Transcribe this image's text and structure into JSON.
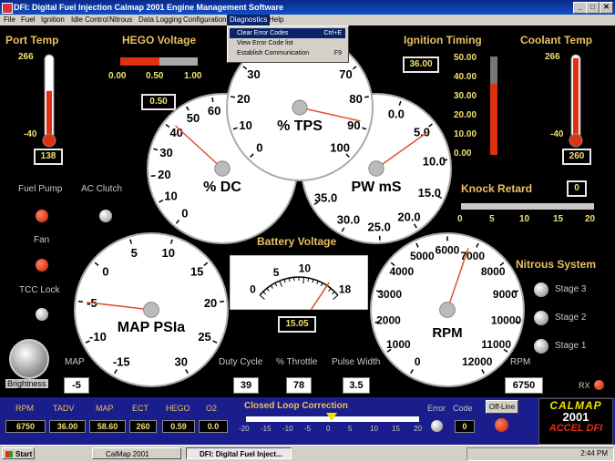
{
  "window": {
    "title": "DFI: Digital Fuel Injection   Calmap 2001 Engine Management Software"
  },
  "menu": [
    "File",
    "Fuel",
    "Ignition",
    "Idle Control",
    "Nitrous",
    "Data Logging",
    "Configuration",
    "Diagnostics",
    "Help"
  ],
  "dropdown": {
    "items": [
      {
        "label": "Clear Error Codes",
        "shortcut": "Ctrl+E"
      },
      {
        "label": "View Error Code list",
        "shortcut": ""
      },
      {
        "label": "Establish Communication",
        "shortcut": "F9"
      }
    ]
  },
  "port_temp": {
    "label": "Port Temp",
    "ticks": [
      "266",
      "-40"
    ],
    "value": "138",
    "level": 0.58
  },
  "coolant_temp": {
    "label": "Coolant Temp",
    "ticks": [
      "266",
      "-40"
    ],
    "value": "260",
    "level": 0.98
  },
  "hego": {
    "label": "HEGO Voltage",
    "ticks": [
      "0.00",
      "0.50",
      "1.00"
    ],
    "value": "0.50"
  },
  "ignition_timing": {
    "label": "Ignition Timing",
    "value": "36.00",
    "ticks": [
      "50.00",
      "40.00",
      "30.00",
      "20.00",
      "10.00",
      "0.00"
    ],
    "level": 0.72
  },
  "tps": {
    "label": "% TPS",
    "ticks": [
      "0",
      "10",
      "20",
      "30",
      "40",
      "50",
      "60",
      "70",
      "80",
      "90",
      "100"
    ],
    "value": 88
  },
  "dc": {
    "label": "% DC",
    "ticks": [
      "0",
      "10",
      "20",
      "30",
      "40",
      "50",
      "60",
      "70",
      "80",
      "90",
      "100"
    ],
    "value": 42
  },
  "pw": {
    "label": "PW mS",
    "ticks": [
      "0.0",
      "5.0",
      "10.0",
      "15.0",
      "20.0",
      "25.0",
      "30.0",
      "35.0"
    ],
    "value": 5.5
  },
  "map": {
    "label": "MAP PSIa",
    "ticks": [
      "-15",
      "-10",
      "-5",
      "0",
      "5",
      "10",
      "15",
      "20",
      "25",
      "30"
    ],
    "value": -5
  },
  "rpm": {
    "label": "RPM",
    "ticks": [
      "0",
      "1000",
      "2000",
      "3000",
      "4000",
      "5000",
      "6000",
      "7000",
      "8000",
      "9000",
      "10000",
      "11000",
      "12000"
    ],
    "value": 6750
  },
  "battery": {
    "label": "Battery Voltage",
    "ticks": [
      "0",
      "5",
      "10",
      "18"
    ],
    "value": "15.05",
    "volts": 15.05
  },
  "knock": {
    "label": "Knock Retard",
    "value": "0",
    "ticks": [
      "0",
      "5",
      "10",
      "15",
      "20"
    ]
  },
  "nitrous": {
    "label": "Nitrous System",
    "stages": [
      "Stage 3",
      "Stage 2",
      "Stage 1"
    ]
  },
  "indicators": {
    "fuel_pump": "Fuel Pump",
    "ac_clutch": "AC Clutch",
    "fan": "Fan",
    "tcc_lock": "TCC Lock",
    "brightness": "Brightness",
    "rx": "RX"
  },
  "readouts": {
    "map_label": "MAP",
    "map_value": "-5",
    "duty_label": "Duty Cycle",
    "duty_value": "39",
    "throttle_label": "% Throttle",
    "throttle_value": "78",
    "pulse_label": "Pulse Width",
    "pulse_value": "3.5",
    "rpm_label": "RPM",
    "rpm_value": "6750"
  },
  "bottom": {
    "tabs": [
      "RPM",
      "TADV",
      "MAP",
      "ECT",
      "HEGO",
      "O2"
    ],
    "values": [
      "6750",
      "36.00",
      "58.60",
      "260",
      "0.59",
      "0.0"
    ],
    "closed_loop_label": "Closed Loop Correction",
    "cl_ticks": [
      "-20",
      "-15",
      "-10",
      "-5",
      "0",
      "5",
      "10",
      "15",
      "20"
    ],
    "error_label": "Error",
    "code_label": "Code",
    "code_value": "0",
    "offline_label": "Off-Line",
    "logo_top": "CALMAP",
    "logo_mid": "2001",
    "logo_bottom": "ACCEL DFI"
  },
  "taskbar": {
    "start": "Start",
    "task1": "CalMap 2001",
    "task2": "DFI: Digital Fuel Inject...",
    "clock": "2:44 PM"
  },
  "colors": {
    "label": "#e8c060",
    "menu_highlight": "#0a246a",
    "needle": "#e05030",
    "led_red": "#e03010",
    "bottom_bar": "#1a1d8c"
  }
}
